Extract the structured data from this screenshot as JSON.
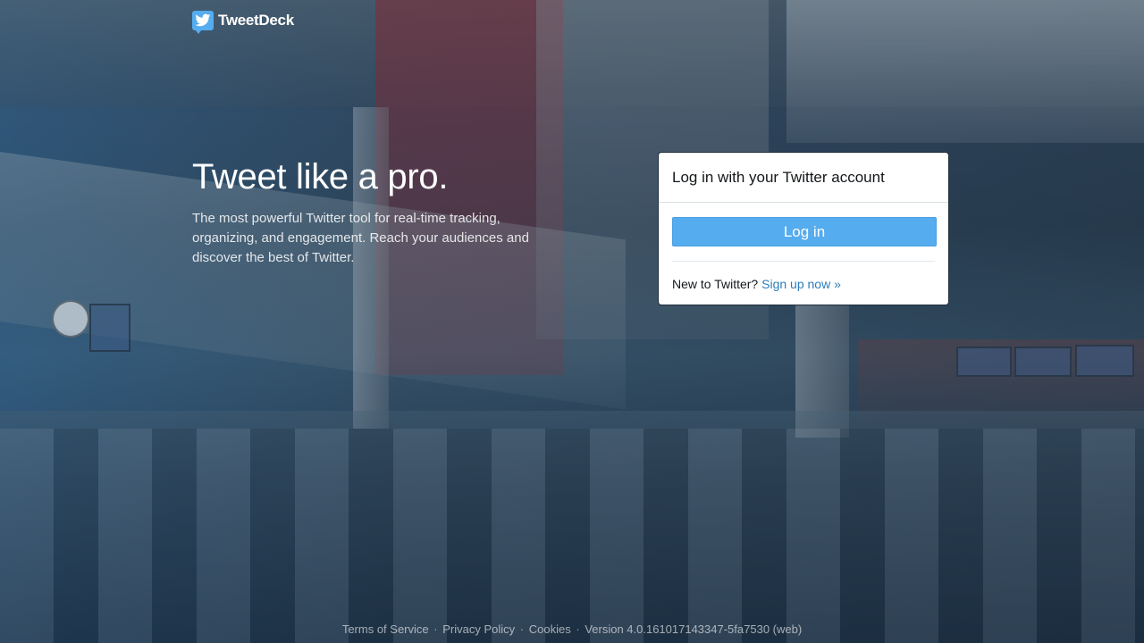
{
  "header": {
    "logo_icon": "twitter-bird-icon",
    "logo_text": "TweetDeck"
  },
  "hero": {
    "title": "Tweet like a pro.",
    "subtitle": "The most powerful Twitter tool for real-time tracking, organizing, and engagement. Reach your audiences and discover the best of Twitter."
  },
  "login": {
    "heading": "Log in with your Twitter account",
    "button_label": "Log in",
    "signup_prompt": "New to Twitter?",
    "signup_link": "Sign up now »"
  },
  "footer": {
    "links": [
      "Terms of Service",
      "Privacy Policy",
      "Cookies"
    ],
    "separator": "·",
    "version": "Version 4.0.161017143347-5fa7530 (web)"
  },
  "colors": {
    "accent": "#55acee",
    "link": "#2b7bb9",
    "card_background": "#ffffff"
  }
}
